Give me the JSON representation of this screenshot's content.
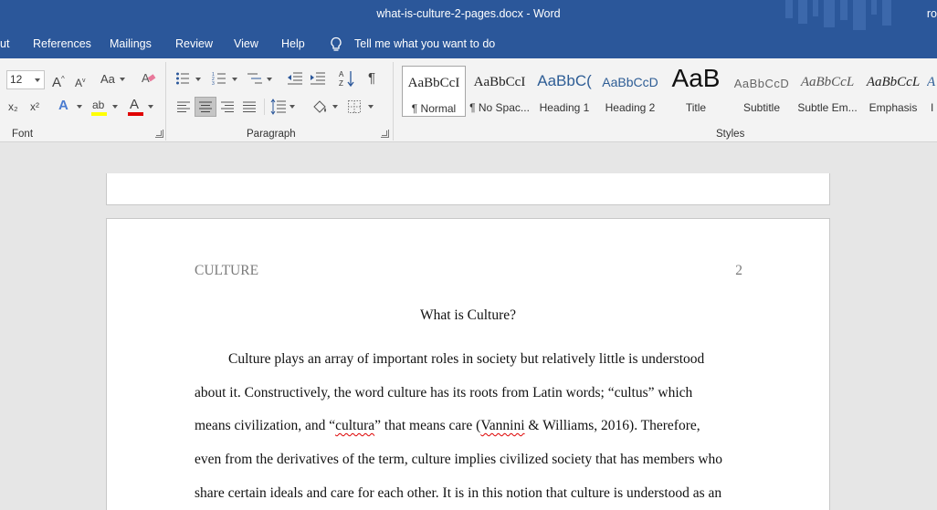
{
  "window": {
    "title": "what-is-culture-2-pages.docx  -  Word",
    "account": "ro"
  },
  "tabs": [
    {
      "label": "ut"
    },
    {
      "label": "References"
    },
    {
      "label": "Mailings"
    },
    {
      "label": "Review"
    },
    {
      "label": "View"
    },
    {
      "label": "Help"
    }
  ],
  "tell_me": {
    "label": "Tell me what you want to do"
  },
  "ribbon": {
    "font": {
      "size": "12",
      "group_label": "Font",
      "grow": "A",
      "shrink": "A",
      "case": "Aa",
      "subscript": "x₂",
      "superscript": "x²",
      "text_effects": "A",
      "highlight": "ab",
      "font_color": "A"
    },
    "paragraph": {
      "group_label": "Paragraph",
      "show_marks": "¶"
    },
    "styles": {
      "group_label": "Styles",
      "items": [
        {
          "preview": "AaBbCcI",
          "label": "¶ Normal"
        },
        {
          "preview": "AaBbCcI",
          "label": "¶ No Spac..."
        },
        {
          "preview": "AaBbC(",
          "label": "Heading 1"
        },
        {
          "preview": "AaBbCcD",
          "label": "Heading 2"
        },
        {
          "preview": "AaB",
          "label": "Title"
        },
        {
          "preview": "AaBbCcD",
          "label": "Subtitle"
        },
        {
          "preview": "AaBbCcL",
          "label": "Subtle Em..."
        },
        {
          "preview": "AaBbCcL",
          "label": "Emphasis"
        },
        {
          "preview": "A",
          "label": "I"
        }
      ]
    },
    "colors": {
      "highlight": "#ffff00",
      "font_color": "#e00000"
    }
  },
  "document": {
    "header_left": "CULTURE",
    "page_number": "2",
    "title": "What is Culture?",
    "lines": {
      "l1": "Culture plays an array of important roles in society but relatively little is understood",
      "l2": "about it. Constructively, the word culture has its roots from Latin words; “cultus” which",
      "l3a": "means civilization, and “",
      "l3b": "cultura",
      "l3c": "” that means care (",
      "l3d": "Vannini",
      "l3e": " & Williams, 2016). Therefore,",
      "l4": "even from the derivatives of the term, culture implies civilized society that has members who",
      "l5": "share certain ideals and care for each other. It is in this notion that culture is understood as an"
    }
  }
}
